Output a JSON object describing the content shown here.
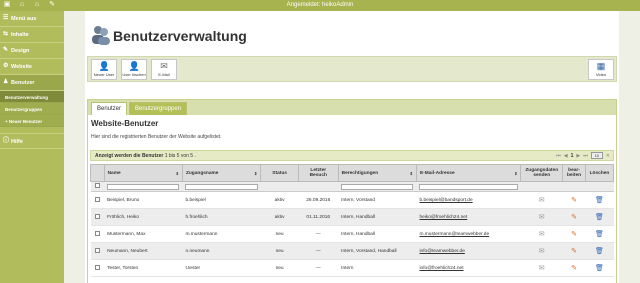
{
  "topbar": {
    "user": "Angemeldet: heikoAdmin",
    "icons": [
      "logo-icon",
      "home-icon",
      "house-icon",
      "edit-icon"
    ]
  },
  "sidebar": {
    "items": [
      {
        "label": "Menü aus",
        "icon": "menu-icon"
      },
      {
        "label": "Inhalte",
        "icon": "content-icon"
      },
      {
        "label": "Design",
        "icon": "design-icon"
      },
      {
        "label": "Website",
        "icon": "gear-icon"
      },
      {
        "label": "Benutzer",
        "icon": "users-icon"
      }
    ],
    "sub": [
      "Benutzerverwaltung",
      "Benutzergruppen",
      "+ Neuer Benutzer"
    ],
    "help": {
      "label": "Hilfe",
      "icon": "info-icon"
    }
  },
  "page": {
    "title": "Benutzerverwaltung"
  },
  "toolbar": {
    "new_user": "Neuer User",
    "delete_user": "User löschen",
    "email": "E-Mail",
    "video": "Video"
  },
  "tabs": [
    "Benutzer",
    "Benutzergruppen"
  ],
  "section": {
    "title": "Website-Benutzer",
    "desc": "Hier sind die registrierten Benutzer der Website aufgelistet.",
    "count_prefix": "Anzeigt werden die Benutzer",
    "count_range": "1 bis 5 von 5 .",
    "page": "1",
    "page_size": "10"
  },
  "table": {
    "headers": [
      "Name",
      "Zugangsname",
      "Status",
      "Letzter Besuch",
      "Berechtigungen",
      "E-Mail-Adresse",
      "Zugangsdaten senden",
      "bear-beiten",
      "Löschen"
    ],
    "rows": [
      {
        "name": "Beispiel, Bruno",
        "login": "b.beispiel",
        "status": "aktiv",
        "visit": "26.09.2016",
        "rights": "Intern, Vorstand",
        "email": "b.beispiel@bandsport.de"
      },
      {
        "name": "Fröhlich, Heiko",
        "login": "h.froehlich",
        "status": "aktiv",
        "visit": "01.11.2016",
        "rights": "Intern, Handball",
        "email": "heiko@froehlich24.net"
      },
      {
        "name": "Mustermann, Max",
        "login": "m.mustermann",
        "status": "neu",
        "visit": "—",
        "rights": "Intern, Handball",
        "email": "m.mustermann@teamwebber.de"
      },
      {
        "name": "Neumann, Neubert",
        "login": "n.neumann",
        "status": "neu",
        "visit": "—",
        "rights": "Intern, Vorstand, Handball",
        "email": "info@teamwebber.de"
      },
      {
        "name": "Tester, Torsten",
        "login": "t.tester",
        "status": "neu",
        "visit": "—",
        "rights": "Intern",
        "email": "info@froehlich24.net"
      }
    ]
  }
}
